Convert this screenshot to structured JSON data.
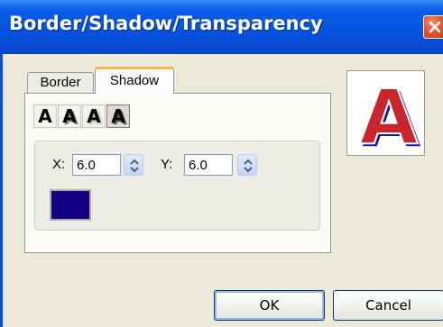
{
  "window": {
    "title": "Border/Shadow/Transparency"
  },
  "tabs": [
    {
      "label": "Border"
    },
    {
      "label": "Shadow"
    }
  ],
  "shadow": {
    "styles": [
      {
        "glyph": "A",
        "icon": "shadow-none-icon"
      },
      {
        "glyph": "A",
        "icon": "shadow-offset-icon"
      },
      {
        "glyph": "A",
        "icon": "shadow-soft-icon"
      },
      {
        "glyph": "A",
        "icon": "shadow-3d-icon"
      }
    ],
    "x_label": "X:",
    "x_value": "6.0",
    "y_label": "Y:",
    "y_value": "6.0",
    "color": "#120082"
  },
  "preview": {
    "glyph": "A"
  },
  "buttons": {
    "ok": "OK",
    "cancel": "Cancel"
  },
  "colors": {
    "title_bar": "#0553e0",
    "close": "#e25a2f",
    "tab_highlight": "#f7b64a",
    "dialog_bg": "#ece9d8"
  }
}
